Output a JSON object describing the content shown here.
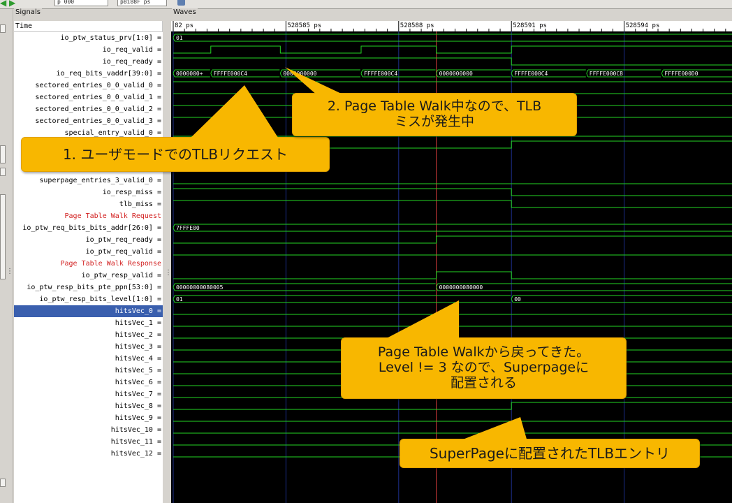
{
  "toolbar": {
    "field1": "p 000",
    "field2": "p8i88F ps"
  },
  "panels": {
    "signals_title": "Signals",
    "waves_title": "Waves",
    "time_header": "Time"
  },
  "signals": [
    {
      "label": "io_ptw_status_prv[1:0] =",
      "type": "signal"
    },
    {
      "label": "io_req_valid =",
      "type": "signal"
    },
    {
      "label": "io_req_ready =",
      "type": "signal"
    },
    {
      "label": "io_req_bits_vaddr[39:0] =",
      "type": "signal"
    },
    {
      "label": "sectored_entries_0_0_valid_0 =",
      "type": "signal"
    },
    {
      "label": "sectored_entries_0_0_valid_1 =",
      "type": "signal"
    },
    {
      "label": "sectored_entries_0_0_valid_2 =",
      "type": "signal"
    },
    {
      "label": "sectored_entries_0_0_valid_3 =",
      "type": "signal"
    },
    {
      "label": "special_entry_valid_0 =",
      "type": "signal"
    },
    {
      "label": "",
      "type": "signal"
    },
    {
      "label": "",
      "type": "signal"
    },
    {
      "label": "",
      "type": "signal"
    },
    {
      "label": "superpage_entries_3_valid_0 =",
      "type": "signal"
    },
    {
      "label": "io_resp_miss =",
      "type": "signal"
    },
    {
      "label": "tlb_miss =",
      "type": "signal"
    },
    {
      "label": "Page Table Walk Request",
      "type": "comment"
    },
    {
      "label": "io_ptw_req_bits_bits_addr[26:0] =",
      "type": "signal"
    },
    {
      "label": "io_ptw_req_ready =",
      "type": "signal"
    },
    {
      "label": "io_ptw_req_valid =",
      "type": "signal"
    },
    {
      "label": "Page Table Walk Response",
      "type": "comment"
    },
    {
      "label": "io_ptw_resp_valid =",
      "type": "signal"
    },
    {
      "label": "io_ptw_resp_bits_pte_ppn[53:0] =",
      "type": "signal"
    },
    {
      "label": "io_ptw_resp_bits_level[1:0] =",
      "type": "signal"
    },
    {
      "label": "hitsVec_0 =",
      "type": "selected"
    },
    {
      "label": "hitsVec_1 =",
      "type": "signal"
    },
    {
      "label": "hitsVec_2 =",
      "type": "signal"
    },
    {
      "label": "hitsVec_3 =",
      "type": "signal"
    },
    {
      "label": "hitsVec_4 =",
      "type": "signal"
    },
    {
      "label": "hitsVec_5 =",
      "type": "signal"
    },
    {
      "label": "hitsVec_6 =",
      "type": "signal"
    },
    {
      "label": "hitsVec_7 =",
      "type": "signal"
    },
    {
      "label": "hitsVec_8 =",
      "type": "signal"
    },
    {
      "label": "hitsVec_9 =",
      "type": "signal"
    },
    {
      "label": "hitsVec_10 =",
      "type": "signal"
    },
    {
      "label": "hitsVec_11 =",
      "type": "signal"
    },
    {
      "label": "hitsVec_12 =",
      "type": "signal"
    }
  ],
  "timeline": {
    "labels": [
      "82 ps",
      "528585 ps",
      "528588 ps",
      "528591 ps",
      "528594 ps",
      "528"
    ],
    "ticks_ps": [
      528582,
      528585,
      528588,
      528591,
      528594,
      528597
    ]
  },
  "colors": {
    "wave": "#23d623",
    "grid": "#1c2f8c",
    "marker": "#d23a3a",
    "value_text": "#ffffff",
    "callout": "#f8b700"
  },
  "waves": [
    {
      "row": 0,
      "kind": "bus",
      "segments": [
        {
          "from": 528582.0,
          "to": 528597.0,
          "value": "01"
        }
      ]
    },
    {
      "row": 1,
      "kind": "bit",
      "initial": 0,
      "edges": [
        {
          "t": 528583.0,
          "v": 1
        },
        {
          "t": 528584.85,
          "v": 0
        },
        {
          "t": 528587.0,
          "v": 1
        },
        {
          "t": 528589.0,
          "v": 0
        },
        {
          "t": 528591.0,
          "v": 1
        }
      ]
    },
    {
      "row": 2,
      "kind": "bit",
      "initial": 1,
      "edges": [
        {
          "t": 528591.0,
          "v": 0
        }
      ]
    },
    {
      "row": 3,
      "kind": "bus",
      "segments": [
        {
          "from": 528582.0,
          "to": 528583.0,
          "value": "0000000+"
        },
        {
          "from": 528583.0,
          "to": 528584.85,
          "value": "FFFFE000C4"
        },
        {
          "from": 528584.85,
          "to": 528587.0,
          "value": "0000000000"
        },
        {
          "from": 528587.0,
          "to": 528589.0,
          "value": "FFFFE000C4"
        },
        {
          "from": 528589.0,
          "to": 528591.0,
          "value": "0000000000"
        },
        {
          "from": 528591.0,
          "to": 528593.0,
          "value": "FFFFE000C4"
        },
        {
          "from": 528593.0,
          "to": 528595.0,
          "value": "FFFFE000C8"
        },
        {
          "from": 528595.0,
          "to": 528597.0,
          "value": "FFFFE000D0"
        }
      ]
    },
    {
      "row": 4,
      "kind": "bit",
      "initial": 1,
      "edges": []
    },
    {
      "row": 5,
      "kind": "bit",
      "initial": 1,
      "edges": []
    },
    {
      "row": 6,
      "kind": "bit",
      "initial": 1,
      "edges": []
    },
    {
      "row": 7,
      "kind": "bit",
      "initial": 1,
      "edges": []
    },
    {
      "row": 8,
      "kind": "bit",
      "initial": 0,
      "edges": []
    },
    {
      "row": 9,
      "kind": "bit",
      "initial": 0,
      "edges": [
        {
          "t": 528591.0,
          "v": 1
        }
      ]
    },
    {
      "row": 12,
      "kind": "bit",
      "initial": 0,
      "edges": []
    },
    {
      "row": 13,
      "kind": "bit",
      "initial": 1,
      "edges": [
        {
          "t": 528591.0,
          "v": 0
        }
      ]
    },
    {
      "row": 14,
      "kind": "bit",
      "initial": 1,
      "edges": [
        {
          "t": 528591.0,
          "v": 0
        }
      ]
    },
    {
      "row": 16,
      "kind": "bus",
      "segments": [
        {
          "from": 528582.0,
          "to": 528597.0,
          "value": "7FFFE00"
        }
      ]
    },
    {
      "row": 17,
      "kind": "bit",
      "initial": 0,
      "edges": [
        {
          "t": 528589.0,
          "v": 1
        }
      ]
    },
    {
      "row": 18,
      "kind": "bit",
      "initial": 0,
      "edges": []
    },
    {
      "row": 20,
      "kind": "bit",
      "initial": 0,
      "edges": [
        {
          "t": 528589.0,
          "v": 1
        },
        {
          "t": 528591.0,
          "v": 0
        }
      ]
    },
    {
      "row": 21,
      "kind": "bus",
      "segments": [
        {
          "from": 528582.0,
          "to": 528589.0,
          "value": "00000000080005"
        },
        {
          "from": 528589.0,
          "to": 528597.0,
          "value": "0000000080000"
        }
      ]
    },
    {
      "row": 22,
      "kind": "bus",
      "segments": [
        {
          "from": 528582.0,
          "to": 528591.0,
          "value": "01"
        },
        {
          "from": 528591.0,
          "to": 528597.0,
          "value": "00"
        }
      ]
    },
    {
      "row": 23,
      "kind": "bit",
      "initial": 0,
      "edges": []
    },
    {
      "row": 24,
      "kind": "bit",
      "initial": 0,
      "edges": []
    },
    {
      "row": 25,
      "kind": "bit",
      "initial": 0,
      "edges": []
    },
    {
      "row": 26,
      "kind": "bit",
      "initial": 0,
      "edges": []
    },
    {
      "row": 27,
      "kind": "bit",
      "initial": 0,
      "edges": []
    },
    {
      "row": 28,
      "kind": "bit",
      "initial": 0,
      "edges": []
    },
    {
      "row": 29,
      "kind": "bit",
      "initial": 0,
      "edges": []
    },
    {
      "row": 30,
      "kind": "bit",
      "initial": 0,
      "edges": []
    },
    {
      "row": 31,
      "kind": "bit",
      "initial": 0,
      "edges": [
        {
          "t": 528591.0,
          "v": 1
        }
      ]
    },
    {
      "row": 32,
      "kind": "bit",
      "initial": 0,
      "edges": []
    },
    {
      "row": 33,
      "kind": "bit",
      "initial": 0,
      "edges": []
    },
    {
      "row": 34,
      "kind": "bit",
      "initial": 0,
      "edges": []
    },
    {
      "row": 35,
      "kind": "bit",
      "initial": 0,
      "edges": []
    }
  ],
  "marker_ps": 528589.0,
  "callouts": [
    {
      "id": "c1",
      "text": "1. ユーザモードでのTLBリクエスト"
    },
    {
      "id": "c2",
      "text": "2. Page Table Walk中なので、TLB\nミスが発生中"
    },
    {
      "id": "c3",
      "text": "Page Table Walkから戻ってきた。\nLevel != 3 なので、Superpageに\n配置される"
    },
    {
      "id": "c4",
      "text": "SuperPageに配置されたTLBエントリ"
    }
  ]
}
